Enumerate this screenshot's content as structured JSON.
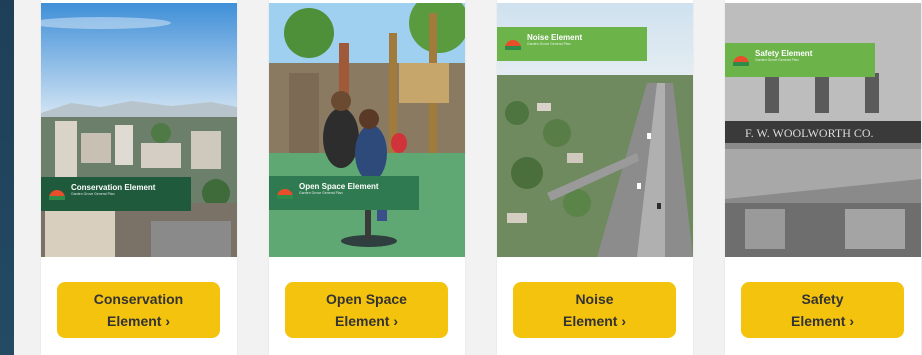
{
  "cards": [
    {
      "cover_title": "Conservation Element",
      "cover_subtitle": "Garden Grove General Plan",
      "button_line1": "Conservation",
      "button_line2": "Element",
      "button_arrow": "›"
    },
    {
      "cover_title": "Open Space Element",
      "cover_subtitle": "Garden Grove General Plan",
      "button_line1": "Open Space",
      "button_line2": "Element",
      "button_arrow": "›"
    },
    {
      "cover_title": "Noise Element",
      "cover_subtitle": "Garden Grove General Plan",
      "button_line1": "Noise",
      "button_line2": "Element",
      "button_arrow": "›"
    },
    {
      "cover_title": "Safety Element",
      "cover_subtitle": "Garden Grove General Plan",
      "button_line1": "Safety",
      "button_line2": "Element",
      "button_arrow": "›"
    }
  ],
  "colors": {
    "button": "#f4c30e",
    "band_dark_green": "#1f5a3c",
    "band_light_green": "#6cb34a",
    "rail": "#1e3f57"
  }
}
